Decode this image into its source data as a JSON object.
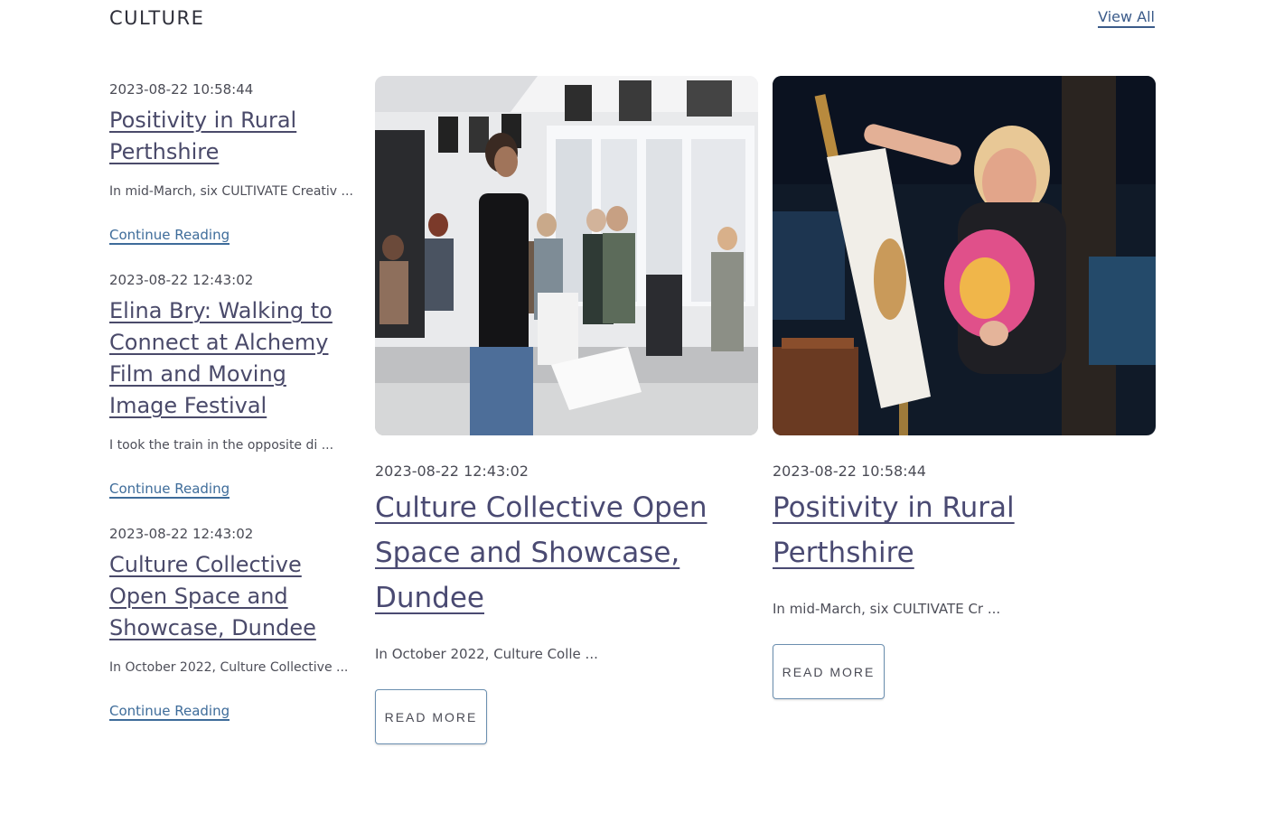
{
  "section": {
    "title": "CULTURE",
    "view_all": "View All"
  },
  "side_list": [
    {
      "date": "2023-08-22 10:58:44",
      "title": "Positivity in Rural Perthshire",
      "excerpt": "In mid-March, six CULTIVATE Creativ ...",
      "link": "Continue Reading"
    },
    {
      "date": "2023-08-22 12:43:02",
      "title": "Elina Bry: Walking to Connect at Alchemy Film and Moving Image Festival",
      "excerpt": "I took the train in the opposite di ...",
      "link": "Continue Reading"
    },
    {
      "date": "2023-08-22 12:43:02",
      "title": "Culture Collective Open Space and Showcase, Dundee",
      "excerpt": "In October 2022, Culture Collective ...",
      "link": "Continue Reading"
    }
  ],
  "cards": [
    {
      "date": "2023-08-22 12:43:02",
      "title": "Culture Collective Open Space and Showcase, Dundee",
      "excerpt": "In October 2022, Culture Colle ...",
      "button": "READ MORE"
    },
    {
      "date": "2023-08-22 10:58:44",
      "title": "Positivity in Rural Perthshire",
      "excerpt": "In mid-March, six CULTIVATE Cr ...",
      "button": "READ MORE"
    }
  ]
}
